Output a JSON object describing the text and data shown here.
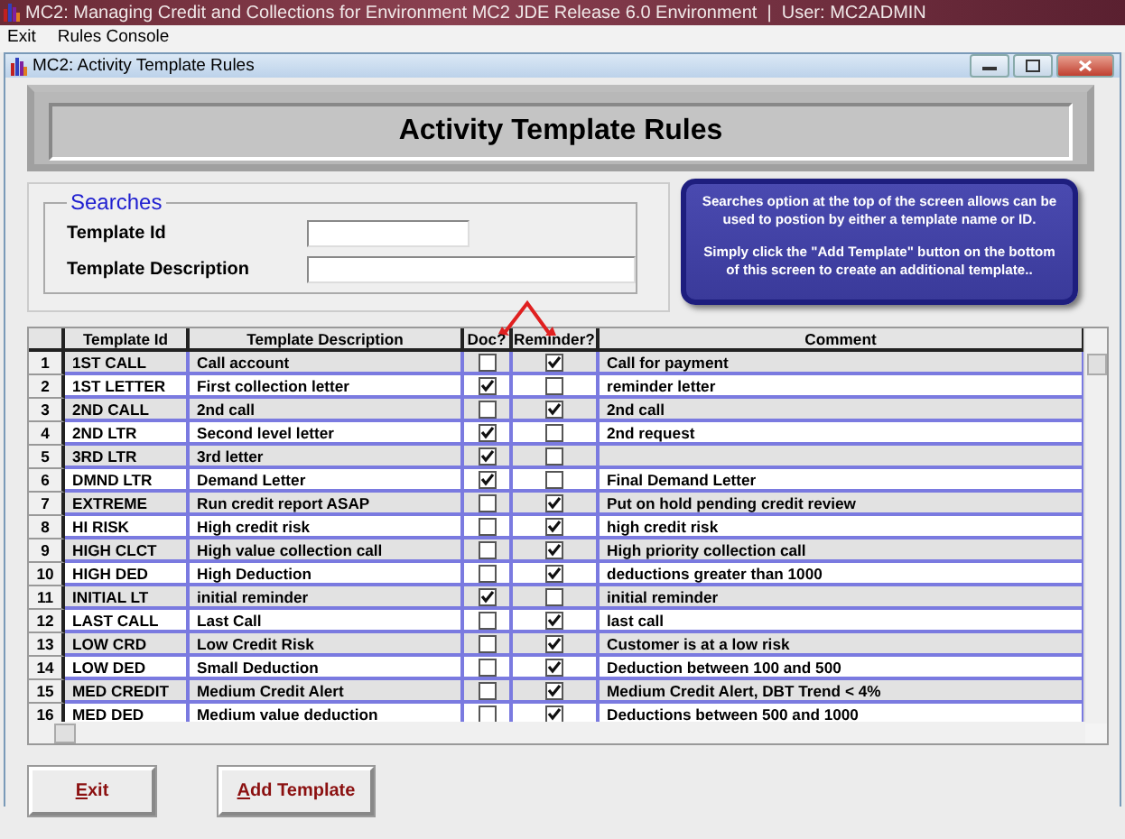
{
  "app": {
    "title": "MC2: Managing Credit and Collections for Environment MC2 JDE Release 6.0 Environment  |  User: MC2ADMIN"
  },
  "menu": [
    "Exit",
    "Rules Console"
  ],
  "window": {
    "title": "MC2: Activity Template Rules"
  },
  "banner": "Activity Template Rules",
  "searches": {
    "title": "Searches",
    "fields": [
      {
        "label": "Template Id",
        "wide": false
      },
      {
        "label": "Template Description",
        "wide": true
      }
    ]
  },
  "note": [
    "Searches option at the top of the screen allows can be used to postion by either a template name or ID.",
    "Simply click the \"Add Template\" button on the bottom of this screen to create an additional template.."
  ],
  "table": {
    "columns": [
      "Template Id",
      "Template Description",
      "Doc?",
      "Reminder?",
      "Comment"
    ],
    "rows": [
      {
        "number": "1",
        "id": "1ST CALL",
        "description": "Call account",
        "doc": false,
        "reminder": true,
        "comment": "Call for payment"
      },
      {
        "number": "2",
        "id": "1ST LETTER",
        "description": "First collection letter",
        "doc": true,
        "reminder": false,
        "comment": "reminder letter"
      },
      {
        "number": "3",
        "id": "2ND CALL",
        "description": "2nd call",
        "doc": false,
        "reminder": true,
        "comment": "2nd call"
      },
      {
        "number": "4",
        "id": "2ND LTR",
        "description": "Second level letter",
        "doc": true,
        "reminder": false,
        "comment": "2nd request"
      },
      {
        "number": "5",
        "id": "3RD LTR",
        "description": "3rd letter",
        "doc": true,
        "reminder": false
      },
      {
        "number": "6",
        "id": "DMND LTR",
        "description": "Demand Letter",
        "doc": true,
        "reminder": false,
        "comment": "Final Demand Letter"
      },
      {
        "number": "7",
        "id": "EXTREME",
        "description": "Run credit report ASAP",
        "doc": false,
        "reminder": true,
        "comment": "Put on hold pending credit review"
      },
      {
        "number": "8",
        "id": "HI RISK",
        "description": "High credit risk",
        "doc": false,
        "reminder": true,
        "comment": "high credit risk"
      },
      {
        "number": "9",
        "id": "HIGH CLCT",
        "description": "High value collection call",
        "doc": false,
        "reminder": true,
        "comment": "High priority collection call"
      },
      {
        "number": "10",
        "id": "HIGH DED",
        "description": "High Deduction",
        "doc": false,
        "reminder": true,
        "comment": "deductions greater than 1000"
      },
      {
        "number": "11",
        "id": "INITIAL LT",
        "description": "initial reminder",
        "doc": true,
        "reminder": false,
        "comment": "initial reminder"
      },
      {
        "number": "12",
        "id": "LAST CALL",
        "description": "Last Call",
        "doc": false,
        "reminder": true,
        "comment": "last call"
      },
      {
        "number": "13",
        "id": "LOW CRD",
        "description": "Low Credit Risk",
        "doc": false,
        "reminder": true,
        "comment": "Customer is at a low risk"
      },
      {
        "number": "14",
        "id": "LOW DED",
        "description": "Small Deduction",
        "doc": false,
        "reminder": true,
        "comment": "Deduction between 100 and 500"
      },
      {
        "number": "15",
        "id": "MED CREDIT",
        "description": "Medium Credit Alert",
        "doc": false,
        "reminder": true,
        "comment": "Medium Credit Alert, DBT Trend < 4%"
      },
      {
        "number": "16",
        "id": "MED DED",
        "description": "Medium value deduction",
        "doc": false,
        "reminder": true,
        "comment": "Deductions between 500 and 1000"
      }
    ]
  },
  "buttons": [
    "Exit",
    "Add Template"
  ]
}
